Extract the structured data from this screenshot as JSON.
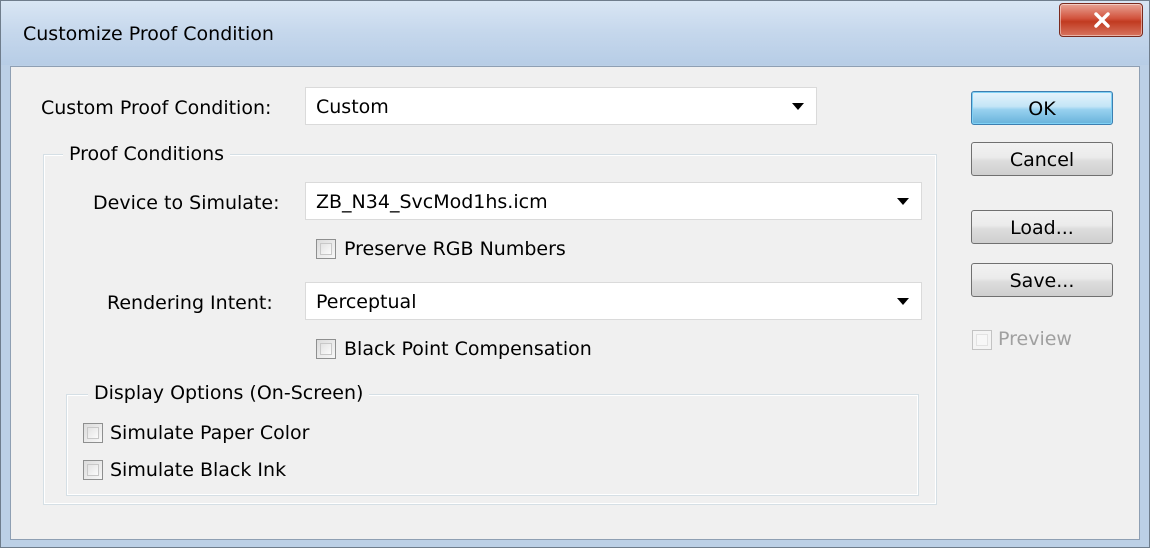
{
  "window": {
    "title": "Customize Proof Condition",
    "close_icon": "close-icon",
    "close_color": "#c7402a"
  },
  "custom_condition": {
    "label": "Custom Proof Condition:",
    "value": "Custom"
  },
  "proof_conditions": {
    "title": "Proof Conditions",
    "device_label": "Device to Simulate:",
    "device_value": "ZB_N34_SvcMod1hs.icm",
    "preserve_rgb_label": "Preserve RGB Numbers",
    "preserve_rgb_checked": false,
    "rendering_label": "Rendering Intent:",
    "rendering_value": "Perceptual",
    "black_point_label": "Black Point Compensation",
    "black_point_checked": false
  },
  "display_options": {
    "title": "Display Options (On-Screen)",
    "paper_color_label": "Simulate Paper Color",
    "paper_color_checked": false,
    "black_ink_label": "Simulate Black Ink",
    "black_ink_checked": false
  },
  "buttons": {
    "ok": "OK",
    "cancel": "Cancel",
    "load": "Load...",
    "save": "Save..."
  },
  "preview": {
    "label": "Preview",
    "checked": false,
    "enabled": false
  }
}
